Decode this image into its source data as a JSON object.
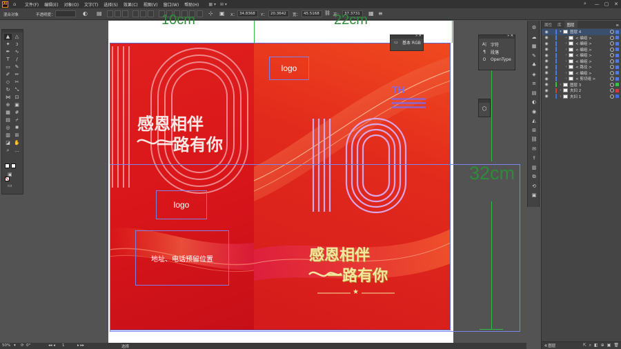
{
  "menubar": {
    "app_badge": "Ai",
    "items": [
      "文件(F)",
      "编辑(E)",
      "对象(O)",
      "文字(T)",
      "选择(S)",
      "效果(C)",
      "视图(V)",
      "窗口(W)",
      "帮助(H)"
    ]
  },
  "controlbar": {
    "selection_label": "混合对象",
    "opacity_label": "不透明度：",
    "x_label": "X：",
    "x_value": "34.8368",
    "y_label": "Y：",
    "y_value": "20.3642",
    "w_label": "宽：",
    "w_value": "45.5168",
    "h_label": "高：",
    "h_value": "37.3731"
  },
  "artwork": {
    "dim_width_left": "10cm",
    "dim_width_right": "22cm",
    "dim_height": "32cm",
    "slogan_line1": "感恩相伴",
    "slogan_line2": "一路有你",
    "logo_text": "logo",
    "address_text": "地址、电话预留位置",
    "big_number": "10",
    "brand_mark": "TH",
    "brand_lines": [
      "",
      "",
      ""
    ],
    "colors": {
      "poster_red": "#e0201e",
      "gold": "#f5e7a0",
      "selection_blue": "#5b6bd6",
      "guide_green": "#2dbf3d"
    }
  },
  "swatch_panel": {
    "label": "基本 RGB"
  },
  "char_panel": {
    "items": [
      "字符",
      "段落",
      "OpenType"
    ]
  },
  "layers_panel": {
    "tabs": [
      "属性",
      "库",
      "图层"
    ],
    "rows": [
      {
        "name": "图层 4",
        "indent": 0,
        "selected": true,
        "color": "#4f7bdc"
      },
      {
        "name": "< 编组 >",
        "indent": 1,
        "selected": false,
        "color": "#4f7bdc"
      },
      {
        "name": "< 编组 >",
        "indent": 1,
        "selected": false,
        "color": "#4f7bdc"
      },
      {
        "name": "< 编组 >",
        "indent": 1,
        "selected": false,
        "color": "#4f7bdc"
      },
      {
        "name": "< 编组 >",
        "indent": 1,
        "selected": false,
        "color": "#4f7bdc"
      },
      {
        "name": "< 编组 >",
        "indent": 1,
        "selected": false,
        "color": "#4f7bdc"
      },
      {
        "name": "< 路径 >",
        "indent": 1,
        "selected": false,
        "color": "#4f7bdc"
      },
      {
        "name": "< 编组 >",
        "indent": 1,
        "selected": false,
        "color": "#4f7bdc"
      },
      {
        "name": "< 剪切组 >",
        "indent": 1,
        "selected": false,
        "color": "#4f7bdc"
      },
      {
        "name": "图层 3",
        "indent": 0,
        "selected": false,
        "color": "#3fbf3f"
      },
      {
        "name": "夫妇 2",
        "indent": 0,
        "selected": false,
        "color": "#d23c3c"
      },
      {
        "name": "夫妇 1",
        "indent": 0,
        "selected": false,
        "color": "#3d6fd8"
      }
    ],
    "footer_count": "4 图层"
  },
  "docbar": {
    "zoom": "50%",
    "rotate": "0°",
    "artboard_num": "1",
    "status": "选择"
  }
}
